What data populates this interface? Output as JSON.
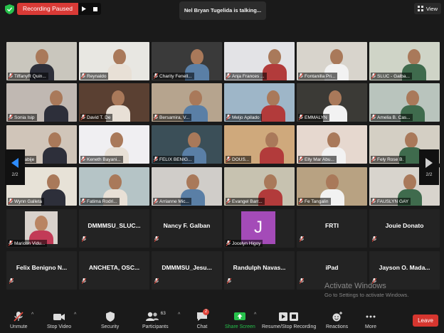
{
  "top": {
    "recording_label": "Recording Paused",
    "talking_text": "Nel Bryan Tugelida is talking...",
    "view_label": "View"
  },
  "nav": {
    "left_page": "2/2",
    "right_page": "2/2"
  },
  "tiles": [
    {
      "name": "TiffanyR Quin...",
      "type": "video",
      "bg": "#c9c6bd"
    },
    {
      "name": "Reynaldo",
      "type": "video",
      "bg": "#e8e7e2"
    },
    {
      "name": "Charity Fenell...",
      "type": "video",
      "bg": "#3a3a3a"
    },
    {
      "name": "Anja Frances ...",
      "type": "video",
      "bg": "#e3e3e6"
    },
    {
      "name": "Fontanilla Pri...",
      "type": "video",
      "bg": "#d8d4cc"
    },
    {
      "name": "SLUC - Galba...",
      "type": "video",
      "bg": "#cfd4c7"
    },
    {
      "name": "Sonia Isip",
      "type": "video",
      "bg": "#c0b8b2"
    },
    {
      "name": "David T. De",
      "type": "video",
      "bg": "#5a4032"
    },
    {
      "name": "Bersamira, V...",
      "type": "video",
      "bg": "#b6a48e"
    },
    {
      "name": "Meljo Apilado",
      "type": "video",
      "bg": "#9eb6c8"
    },
    {
      "name": "EMMALYN",
      "type": "video",
      "bg": "#3b3a36"
    },
    {
      "name": "Amelia B. Cas...",
      "type": "video",
      "bg": "#b9c4bd"
    },
    {
      "name": "a b. tabije",
      "type": "video",
      "bg": "#d0c5b9"
    },
    {
      "name": "Keneth Bayani...",
      "type": "video",
      "bg": "#f0eff2"
    },
    {
      "name": "FELIX BENIG...",
      "type": "video",
      "bg": "#3b4f58"
    },
    {
      "name": "DOUS...",
      "type": "video",
      "bg": "#cfa97c"
    },
    {
      "name": "Elly Mar Abu...",
      "type": "video",
      "bg": "#e6d8cf"
    },
    {
      "name": "Fely Rose B.",
      "type": "video",
      "bg": "#d4cfc4"
    },
    {
      "name": "Wynn Galleta",
      "type": "video",
      "bg": "#e7e2d7"
    },
    {
      "name": "Fatima Rodri...",
      "type": "video",
      "bg": "#b5c4c6"
    },
    {
      "name": "Arrianne Mic...",
      "type": "video",
      "bg": "#d0cdc9"
    },
    {
      "name": "Evangel Barr...",
      "type": "video",
      "bg": "#c7c2b0"
    },
    {
      "name": "Fe Tangalin",
      "type": "video",
      "bg": "#b8a282"
    },
    {
      "name": "FAUSLYN GAY",
      "type": "video",
      "bg": "#d8d4cd"
    },
    {
      "name": "Maricon Vidu...",
      "type": "photo",
      "bg": "#232323"
    },
    {
      "name": "DMMMSU_SLUC...",
      "type": "name"
    },
    {
      "name": "Nancy F. Galban",
      "type": "name"
    },
    {
      "name": "Jocelyn Higoy",
      "type": "avatar",
      "letter": "J"
    },
    {
      "name": "FRTI",
      "type": "name"
    },
    {
      "name": "Jouie Donato",
      "type": "name"
    },
    {
      "name": "Felix Benigno N...",
      "type": "name"
    },
    {
      "name": "ANCHETA, OSC...",
      "type": "name"
    },
    {
      "name": "DMMMSU_Jesu...",
      "type": "name"
    },
    {
      "name": "Randulph Navas...",
      "type": "name"
    },
    {
      "name": "iPad",
      "type": "name"
    },
    {
      "name": "Jayson O. Mada...",
      "type": "name"
    }
  ],
  "watermark": {
    "title": "Activate Windows",
    "subtitle": "Go to Settings to activate Windows."
  },
  "toolbar": {
    "unmute": "Unmute",
    "stop_video": "Stop Video",
    "security": "Security",
    "participants": "Participants",
    "participants_count": "63",
    "chat": "Chat",
    "chat_badge": "2",
    "share_screen": "Share Screen",
    "recording": "Resume/Stop Recording",
    "reactions": "Reactions",
    "more": "More",
    "leave": "Leave"
  },
  "colors": {
    "accent_green": "#27c24c",
    "record_red": "#d93a36",
    "avatar_purple": "#a44bb8",
    "mic_red": "#e04a3f"
  }
}
